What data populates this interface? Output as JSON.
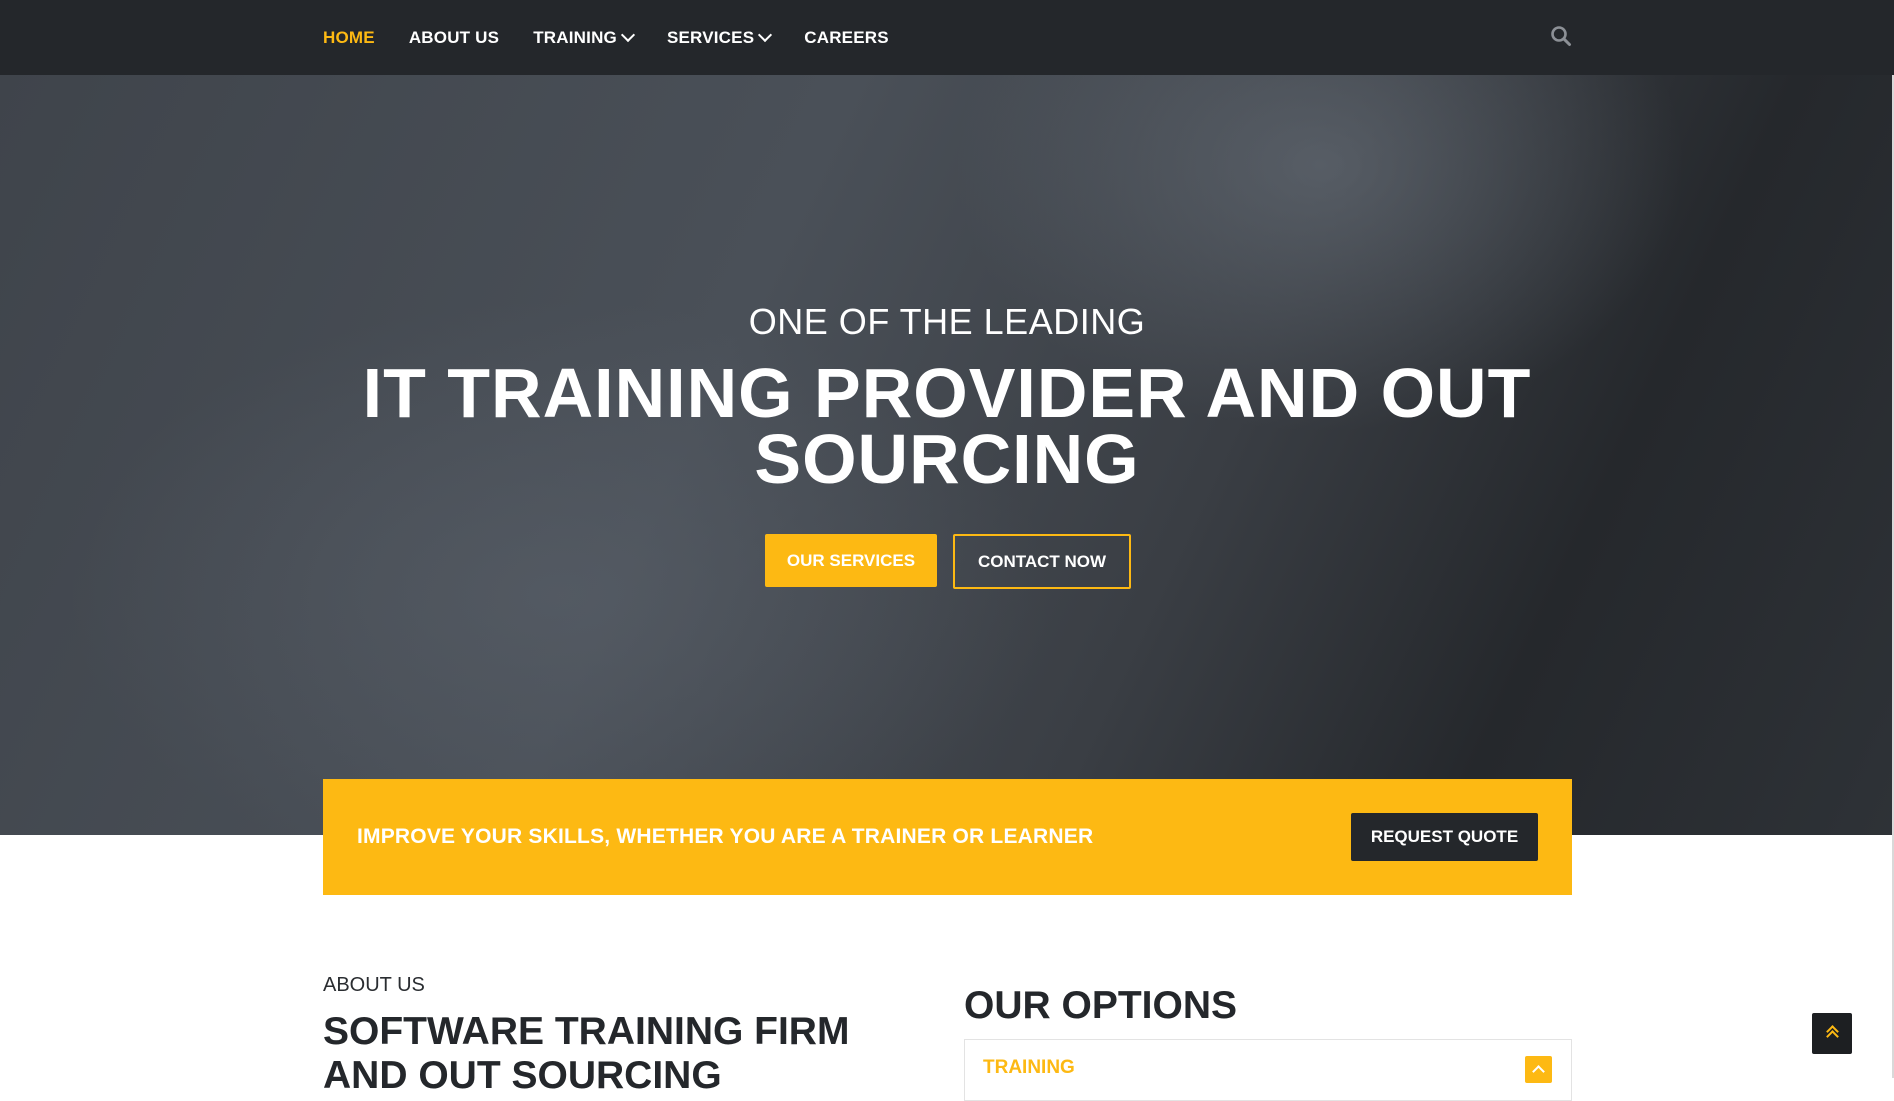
{
  "nav": {
    "items": [
      {
        "label": "HOME",
        "active": true,
        "has_dropdown": false
      },
      {
        "label": "ABOUT US",
        "active": false,
        "has_dropdown": false
      },
      {
        "label": "TRAINING",
        "active": false,
        "has_dropdown": true
      },
      {
        "label": "SERVICES",
        "active": false,
        "has_dropdown": true
      },
      {
        "label": "CAREERS",
        "active": false,
        "has_dropdown": false
      }
    ],
    "search_icon": "search-icon"
  },
  "hero": {
    "subtitle": "ONE OF THE LEADING",
    "title": "IT TRAINING PROVIDER AND OUT SOURCING",
    "primary_button": "OUR SERVICES",
    "secondary_button": "CONTACT NOW"
  },
  "cta": {
    "text": "IMPROVE YOUR SKILLS, WHETHER YOU ARE A TRAINER OR LEARNER",
    "button": "REQUEST QUOTE"
  },
  "about": {
    "eyebrow": "ABOUT US",
    "title": "SOFTWARE TRAINING FIRM AND OUT SOURCING"
  },
  "options": {
    "title": "OUR OPTIONS",
    "accordion": [
      {
        "label": "TRAINING",
        "expanded": true
      }
    ]
  },
  "scroll_top_icon": "double-chevron-up-icon",
  "colors": {
    "accent": "#fdb913",
    "dark": "#24272b",
    "white": "#ffffff"
  }
}
